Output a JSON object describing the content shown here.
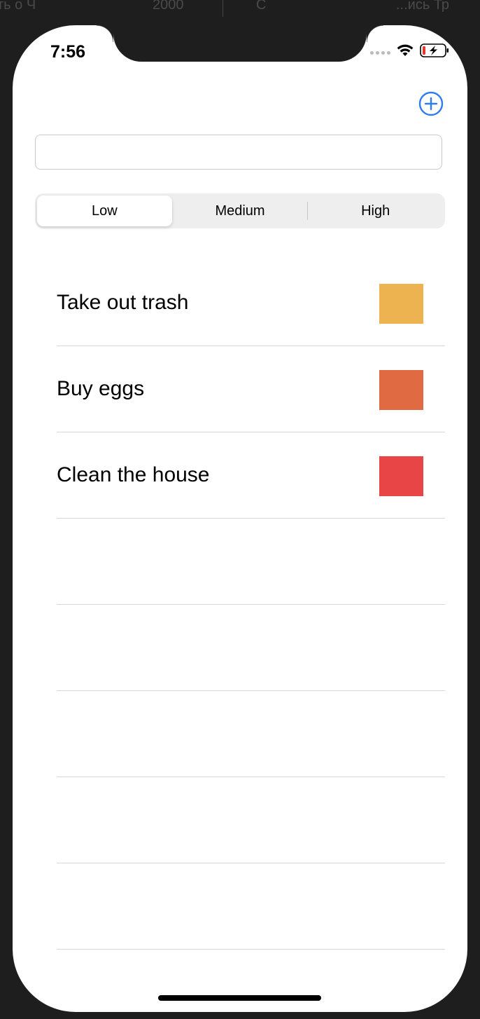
{
  "background_strip": [
    "ть о Ч",
    "2000",
    "С",
    "...ись Тр"
  ],
  "status_bar": {
    "time": "7:56"
  },
  "text_field": {
    "value": "",
    "placeholder": ""
  },
  "priority_control": {
    "segments": [
      "Low",
      "Medium",
      "High"
    ],
    "selected": "Low"
  },
  "tasks": [
    {
      "title": "Take out trash",
      "color": "#ecb350"
    },
    {
      "title": "Buy eggs",
      "color": "#e06a41"
    },
    {
      "title": "Clean the house",
      "color": "#e84646"
    }
  ],
  "colors": {
    "accent": "#2f7bf5",
    "separator": "#d6d6d6",
    "segment_bg": "#eeeeef"
  },
  "icons": {
    "add": "plus-circle-icon",
    "wifi": "wifi-icon",
    "battery": "battery-charging-icon"
  }
}
